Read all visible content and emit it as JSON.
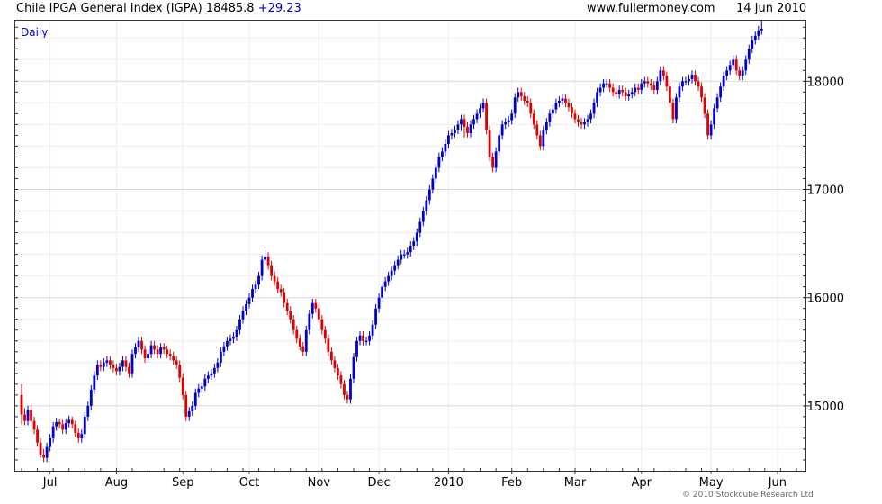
{
  "header": {
    "title": "Chile IPGA General Index (IGPA) 18485.8",
    "change": "+29.23",
    "site": "www.fullermoney.com",
    "date": "14 Jun 2010"
  },
  "chart": {
    "period_label": "Daily",
    "copyright": "© 2010 Stockcube Research Ltd"
  },
  "colors": {
    "up": "#0000cc",
    "down": "#dd0000",
    "grid": "#d8d8d8",
    "grid_minor": "#eeeeee"
  },
  "chart_data": {
    "type": "candlestick",
    "title": "Chile IPGA General Index (IGPA)",
    "ylim": [
      14400,
      18560
    ],
    "yticks": [
      15000,
      16000,
      17000,
      18000
    ],
    "ytick_labels": [
      "15000",
      "16000",
      "17000",
      "18000"
    ],
    "xticks": [
      "Jul",
      "Aug",
      "Sep",
      "Oct",
      "Nov",
      "Dec",
      "2010",
      "Feb",
      "Mar",
      "Apr",
      "May",
      "Jun"
    ],
    "xtick_positions": [
      9,
      30,
      51,
      72,
      94,
      113,
      135,
      155,
      175,
      196,
      218,
      239
    ],
    "n_bars": 248,
    "series": [
      {
        "close": [
          14920,
          14860,
          14960,
          14860,
          14780,
          14660,
          14550,
          14520,
          14620,
          14700,
          14810,
          14850,
          14830,
          14780,
          14840,
          14870,
          14830,
          14750,
          14700,
          14740,
          14900,
          15000,
          15150,
          15280,
          15380,
          15360,
          15400,
          15420,
          15380,
          15350,
          15320,
          15360,
          15420,
          15360,
          15300,
          15480,
          15540,
          15600,
          15520,
          15440,
          15480,
          15560,
          15520,
          15480,
          15540,
          15520,
          15480,
          15460,
          15420,
          15380,
          15260,
          15100,
          14900,
          14950,
          15000,
          15120,
          15160,
          15180,
          15250,
          15280,
          15300,
          15350,
          15400,
          15500,
          15550,
          15600,
          15620,
          15640,
          15700,
          15800,
          15880,
          15940,
          16000,
          16080,
          16120,
          16200,
          16350,
          16380,
          16300,
          16200,
          16150,
          16080,
          16050,
          15950,
          15880,
          15800,
          15700,
          15620,
          15550,
          15500,
          15700,
          15850,
          15950,
          15900,
          15800,
          15700,
          15620,
          15500,
          15420,
          15350,
          15280,
          15200,
          15100,
          15060,
          15250,
          15450,
          15600,
          15650,
          15600,
          15600,
          15650,
          15750,
          15900,
          16000,
          16100,
          16150,
          16200,
          16250,
          16300,
          16350,
          16400,
          16400,
          16420,
          16480,
          16520,
          16600,
          16700,
          16800,
          16900,
          17000,
          17100,
          17200,
          17300,
          17350,
          17420,
          17500,
          17520,
          17550,
          17600,
          17650,
          17580,
          17520,
          17600,
          17650,
          17700,
          17750,
          17800,
          17550,
          17300,
          17200,
          17350,
          17500,
          17600,
          17620,
          17640,
          17700,
          17850,
          17900,
          17860,
          17820,
          17800,
          17700,
          17600,
          17500,
          17400,
          17550,
          17620,
          17700,
          17740,
          17800,
          17820,
          17840,
          17800,
          17760,
          17700,
          17650,
          17620,
          17600,
          17620,
          17650,
          17700,
          17800,
          17900,
          17940,
          17980,
          17980,
          17940,
          17900,
          17880,
          17920,
          17900,
          17860,
          17880,
          17900,
          17940,
          17920,
          17980,
          18000,
          17980,
          17960,
          17920,
          18000,
          18100,
          18050,
          17950,
          17800,
          17650,
          17850,
          17950,
          18000,
          18000,
          18020,
          18060,
          18000,
          17950,
          17850,
          17700,
          17500,
          17600,
          17750,
          17850,
          17950,
          18050,
          18100,
          18150,
          18200,
          18100,
          18050,
          18100,
          18200,
          18300,
          18380,
          18420,
          18470,
          18485.8
        ],
        "open": [
          15100,
          14920,
          14860,
          14960,
          14860,
          14780,
          14660,
          14550,
          14520,
          14620,
          14700,
          14810,
          14850,
          14830,
          14780,
          14840,
          14870,
          14830,
          14750,
          14700,
          14740,
          14900,
          15000,
          15150,
          15280,
          15380,
          15360,
          15400,
          15420,
          15380,
          15350,
          15320,
          15360,
          15420,
          15360,
          15300,
          15480,
          15540,
          15600,
          15520,
          15440,
          15480,
          15560,
          15520,
          15480,
          15540,
          15520,
          15480,
          15460,
          15420,
          15380,
          15260,
          15100,
          14900,
          14950,
          15000,
          15120,
          15160,
          15180,
          15250,
          15280,
          15300,
          15350,
          15400,
          15500,
          15550,
          15600,
          15620,
          15640,
          15700,
          15800,
          15880,
          15940,
          16000,
          16080,
          16120,
          16200,
          16350,
          16380,
          16300,
          16200,
          16150,
          16080,
          16050,
          15950,
          15880,
          15800,
          15700,
          15620,
          15550,
          15500,
          15700,
          15850,
          15950,
          15900,
          15800,
          15700,
          15620,
          15500,
          15420,
          15350,
          15280,
          15200,
          15100,
          15060,
          15250,
          15450,
          15600,
          15650,
          15600,
          15600,
          15650,
          15750,
          15900,
          16000,
          16100,
          16150,
          16200,
          16250,
          16300,
          16350,
          16400,
          16400,
          16420,
          16480,
          16520,
          16600,
          16700,
          16800,
          16900,
          17000,
          17100,
          17200,
          17300,
          17350,
          17420,
          17500,
          17520,
          17550,
          17600,
          17650,
          17580,
          17520,
          17600,
          17650,
          17700,
          17750,
          17800,
          17550,
          17300,
          17200,
          17350,
          17500,
          17600,
          17620,
          17640,
          17700,
          17850,
          17900,
          17860,
          17820,
          17800,
          17700,
          17600,
          17500,
          17400,
          17550,
          17620,
          17700,
          17740,
          17800,
          17820,
          17840,
          17800,
          17760,
          17700,
          17650,
          17620,
          17600,
          17620,
          17650,
          17700,
          17800,
          17900,
          17940,
          17980,
          17980,
          17940,
          17900,
          17880,
          17920,
          17900,
          17860,
          17880,
          17900,
          17940,
          17920,
          17980,
          18000,
          17980,
          17960,
          17920,
          18000,
          18100,
          18050,
          17950,
          17800,
          17650,
          17850,
          17950,
          18000,
          18000,
          18020,
          18060,
          18000,
          17950,
          17850,
          17700,
          17500,
          17600,
          17750,
          17850,
          17950,
          18050,
          18100,
          18150,
          18200,
          18100,
          18050,
          18100,
          18200,
          18300,
          18380,
          18420,
          18470
        ],
        "high": [
          15200,
          14980,
          15000,
          15010,
          14900,
          14820,
          14700,
          14600,
          14660,
          14740,
          14850,
          14890,
          14880,
          14870,
          14880,
          14910,
          14900,
          14860,
          14790,
          14780,
          14940,
          15040,
          15190,
          15320,
          15420,
          15420,
          15440,
          15460,
          15460,
          15420,
          15390,
          15400,
          15460,
          15460,
          15400,
          15520,
          15580,
          15640,
          15640,
          15560,
          15520,
          15600,
          15600,
          15560,
          15580,
          15580,
          15560,
          15520,
          15500,
          15460,
          15420,
          15300,
          15140,
          14990,
          15040,
          15160,
          15200,
          15220,
          15290,
          15320,
          15340,
          15390,
          15440,
          15540,
          15590,
          15640,
          15660,
          15680,
          15740,
          15840,
          15920,
          15980,
          16040,
          16120,
          16160,
          16240,
          16390,
          16440,
          16420,
          16340,
          16240,
          16190,
          16120,
          16090,
          15990,
          15920,
          15840,
          15740,
          15660,
          15590,
          15740,
          15890,
          15990,
          15990,
          15940,
          15840,
          15740,
          15660,
          15540,
          15460,
          15390,
          15320,
          15240,
          15140,
          15290,
          15490,
          15640,
          15690,
          15690,
          15640,
          15690,
          15790,
          15940,
          16040,
          16140,
          16190,
          16240,
          16290,
          16340,
          16390,
          16440,
          16440,
          16460,
          16520,
          16560,
          16640,
          16740,
          16840,
          16940,
          17040,
          17140,
          17240,
          17340,
          17390,
          17460,
          17540,
          17560,
          17590,
          17640,
          17690,
          17690,
          17620,
          17640,
          17690,
          17740,
          17790,
          17840,
          17840,
          17590,
          17340,
          17390,
          17540,
          17640,
          17660,
          17680,
          17740,
          17890,
          17940,
          17940,
          17900,
          17860,
          17840,
          17740,
          17640,
          17540,
          17590,
          17660,
          17740,
          17780,
          17840,
          17860,
          17880,
          17880,
          17840,
          17800,
          17740,
          17690,
          17660,
          17660,
          17690,
          17740,
          17840,
          17940,
          17980,
          18020,
          18020,
          18020,
          17980,
          17940,
          17960,
          17960,
          17940,
          17920,
          17940,
          17980,
          17980,
          18020,
          18040,
          18040,
          18020,
          18000,
          18040,
          18140,
          18140,
          18090,
          17990,
          17840,
          17890,
          17990,
          18040,
          18040,
          18060,
          18100,
          18100,
          18040,
          17990,
          17890,
          17740,
          17640,
          17790,
          17890,
          17990,
          18090,
          18140,
          18190,
          18240,
          18240,
          18140,
          18140,
          18240,
          18340,
          18420,
          18460,
          18510,
          18560
        ],
        "low": [
          14830,
          14820,
          14820,
          14820,
          14740,
          14620,
          14520,
          14480,
          14480,
          14580,
          14660,
          14770,
          14790,
          14740,
          14740,
          14800,
          14790,
          14710,
          14660,
          14660,
          14700,
          14860,
          14960,
          15110,
          15240,
          15320,
          15320,
          15360,
          15340,
          15310,
          15280,
          15280,
          15320,
          15320,
          15260,
          15260,
          15440,
          15500,
          15480,
          15400,
          15400,
          15440,
          15480,
          15440,
          15440,
          15480,
          15440,
          15420,
          15380,
          15340,
          15220,
          15060,
          14860,
          14860,
          14910,
          14960,
          15080,
          15120,
          15140,
          15210,
          15240,
          15260,
          15310,
          15360,
          15460,
          15510,
          15560,
          15580,
          15600,
          15660,
          15760,
          15840,
          15900,
          15960,
          16040,
          16080,
          16160,
          16310,
          16260,
          16160,
          16110,
          16040,
          16010,
          15910,
          15840,
          15760,
          15660,
          15580,
          15510,
          15460,
          15460,
          15660,
          15810,
          15860,
          15760,
          15660,
          15580,
          15460,
          15380,
          15310,
          15240,
          15160,
          15060,
          15020,
          15020,
          15210,
          15410,
          15560,
          15560,
          15560,
          15560,
          15610,
          15710,
          15860,
          15960,
          16060,
          16110,
          16160,
          16210,
          16260,
          16310,
          16360,
          16360,
          16380,
          16440,
          16480,
          16560,
          16660,
          16760,
          16860,
          16960,
          17060,
          17160,
          17260,
          17310,
          17380,
          17460,
          17480,
          17510,
          17540,
          17480,
          17480,
          17480,
          17560,
          17610,
          17660,
          17710,
          17510,
          17260,
          17160,
          17160,
          17310,
          17460,
          17560,
          17580,
          17600,
          17660,
          17810,
          17820,
          17780,
          17760,
          17660,
          17560,
          17460,
          17360,
          17360,
          17510,
          17580,
          17660,
          17700,
          17760,
          17780,
          17760,
          17720,
          17660,
          17610,
          17580,
          17560,
          17560,
          17580,
          17610,
          17660,
          17760,
          17860,
          17900,
          17940,
          17900,
          17860,
          17840,
          17840,
          17860,
          17820,
          17820,
          17840,
          17860,
          17880,
          17880,
          17940,
          17940,
          17920,
          17880,
          17880,
          17960,
          18010,
          17910,
          17760,
          17610,
          17610,
          17810,
          17910,
          17960,
          17960,
          17980,
          17960,
          17910,
          17810,
          17660,
          17460,
          17460,
          17560,
          17710,
          17810,
          17910,
          18010,
          18060,
          18110,
          18060,
          18010,
          18010,
          18060,
          18160,
          18260,
          18340,
          18380,
          18430
        ]
      }
    ],
    "grid": true,
    "legend": "none"
  }
}
